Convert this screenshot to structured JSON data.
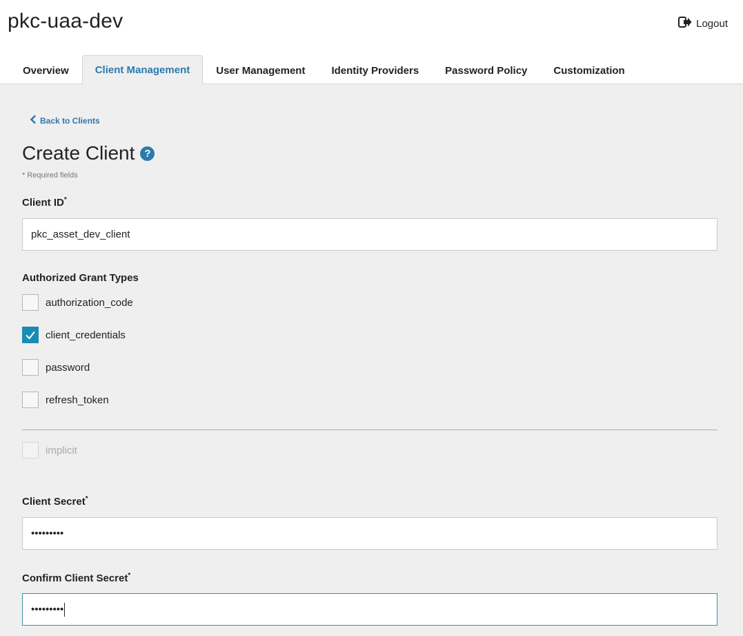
{
  "header": {
    "app_title": "pkc-uaa-dev",
    "logout_label": "Logout"
  },
  "tabs": [
    {
      "label": "Overview",
      "active": false
    },
    {
      "label": "Client Management",
      "active": true
    },
    {
      "label": "User Management",
      "active": false
    },
    {
      "label": "Identity Providers",
      "active": false
    },
    {
      "label": "Password Policy",
      "active": false
    },
    {
      "label": "Customization",
      "active": false
    }
  ],
  "main": {
    "back_label": "Back to Clients",
    "page_title": "Create Client",
    "required_note": "* Required fields",
    "client_id": {
      "label": "Client ID",
      "required_mark": "*",
      "value": "pkc_asset_dev_client"
    },
    "grant_types": {
      "label": "Authorized Grant Types",
      "options": [
        {
          "label": "authorization_code",
          "checked": false,
          "disabled": false
        },
        {
          "label": "client_credentials",
          "checked": true,
          "disabled": false
        },
        {
          "label": "password",
          "checked": false,
          "disabled": false
        },
        {
          "label": "refresh_token",
          "checked": false,
          "disabled": false
        }
      ],
      "extra_option": {
        "label": "implicit",
        "checked": false,
        "disabled": true
      }
    },
    "client_secret": {
      "label": "Client Secret",
      "required_mark": "*",
      "masked_value": "•••••••••"
    },
    "confirm_secret": {
      "label": "Confirm Client Secret",
      "required_mark": "*",
      "masked_value": "•••••••••"
    }
  },
  "colors": {
    "accent": "#2a7bac",
    "checkbox_checked": "#1a8bb3",
    "page_bg": "#efefef"
  },
  "icons": {
    "logout": "logout-icon",
    "back": "chevron-left-icon",
    "help": "question-circle-icon",
    "check": "checkmark-icon"
  }
}
